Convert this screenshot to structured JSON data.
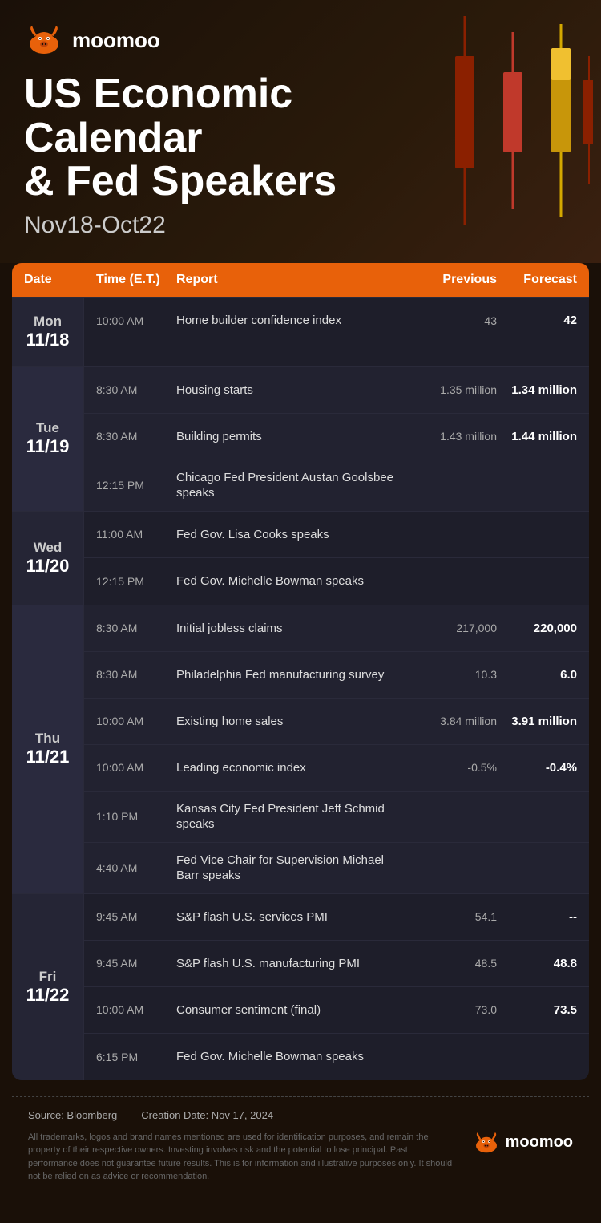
{
  "brand": {
    "name": "moomoo",
    "logo_alt": "moomoo bull logo"
  },
  "header": {
    "title_line1": "US Economic Calendar",
    "title_line2": "& Fed Speakers",
    "date_range": "Nov18-Oct22"
  },
  "table": {
    "columns": {
      "date": "Date",
      "time": "Time (E.T.)",
      "report": "Report",
      "previous": "Previous",
      "forecast": "Forecast"
    },
    "days": [
      {
        "day_name": "Mon",
        "day_date": "11/18",
        "events": [
          {
            "time": "10:00 AM",
            "report": "Home builder confidence index",
            "previous": "43",
            "forecast": "42"
          }
        ]
      },
      {
        "day_name": "Tue",
        "day_date": "11/19",
        "events": [
          {
            "time": "8:30 AM",
            "report": "Housing starts",
            "previous": "1.35 million",
            "forecast": "1.34 million"
          },
          {
            "time": "8:30 AM",
            "report": "Building permits",
            "previous": "1.43 million",
            "forecast": "1.44 million"
          },
          {
            "time": "12:15 PM",
            "report": "Chicago Fed President Austan Goolsbee speaks",
            "previous": "",
            "forecast": ""
          }
        ]
      },
      {
        "day_name": "Wed",
        "day_date": "11/20",
        "events": [
          {
            "time": "11:00 AM",
            "report": "Fed Gov. Lisa Cooks speaks",
            "previous": "",
            "forecast": ""
          },
          {
            "time": "12:15 PM",
            "report": "Fed Gov. Michelle Bowman speaks",
            "previous": "",
            "forecast": ""
          }
        ]
      },
      {
        "day_name": "Thu",
        "day_date": "11/21",
        "events": [
          {
            "time": "8:30 AM",
            "report": "Initial jobless claims",
            "previous": "217,000",
            "forecast": "220,000"
          },
          {
            "time": "8:30 AM",
            "report": "Philadelphia Fed manufacturing survey",
            "previous": "10.3",
            "forecast": "6.0"
          },
          {
            "time": "10:00 AM",
            "report": "Existing home sales",
            "previous": "3.84 million",
            "forecast": "3.91 million"
          },
          {
            "time": "10:00 AM",
            "report": "Leading economic index",
            "previous": "-0.5%",
            "forecast": "-0.4%"
          },
          {
            "time": "1:10 PM",
            "report": "Kansas City Fed President Jeff Schmid speaks",
            "previous": "",
            "forecast": ""
          },
          {
            "time": "4:40 AM",
            "report": "Fed Vice Chair for Supervision Michael Barr speaks",
            "previous": "",
            "forecast": ""
          }
        ]
      },
      {
        "day_name": "Fri",
        "day_date": "11/22",
        "events": [
          {
            "time": "9:45 AM",
            "report": "S&P flash U.S. services PMI",
            "previous": "54.1",
            "forecast": "--"
          },
          {
            "time": "9:45 AM",
            "report": "S&P flash U.S. manufacturing PMI",
            "previous": "48.5",
            "forecast": "48.8"
          },
          {
            "time": "10:00 AM",
            "report": "Consumer sentiment (final)",
            "previous": "73.0",
            "forecast": "73.5"
          },
          {
            "time": "6:15 PM",
            "report": "Fed Gov. Michelle Bowman speaks",
            "previous": "",
            "forecast": ""
          }
        ]
      }
    ]
  },
  "footer": {
    "source_label": "Source: Bloomberg",
    "creation_label": "Creation Date: Nov 17, 2024",
    "disclaimer": "All trademarks, logos and brand names mentioned are used for identification purposes, and remain the property of their respective owners. Investing involves risk and the potential to lose principal. Past performance does not guarantee future results. This is for information and illustrative purposes only. It should not be relied on as advice or recommendation."
  }
}
